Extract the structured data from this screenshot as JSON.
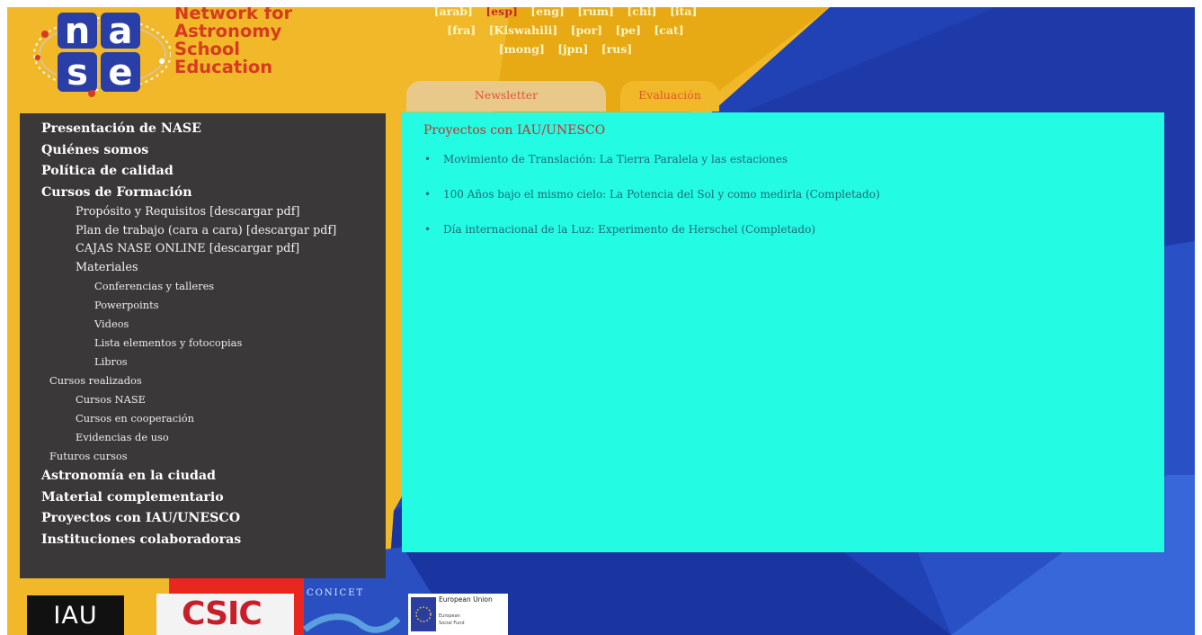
{
  "brand": {
    "title_lines": [
      "Network for",
      "Astronomy",
      "School",
      "Education"
    ],
    "logo_letters": [
      "n",
      "a",
      "s",
      "e"
    ],
    "colors": {
      "brand_red": "#d63a1f",
      "panel_cyan": "#23fbe3",
      "sidebar_dark": "#3b3839",
      "accent_yellow": "#f1b92a",
      "bg_blue": "#2346b8"
    }
  },
  "languages": {
    "rows": [
      [
        "[arab]",
        "[esp]",
        "[eng]",
        "[rum]",
        "[chi]",
        "[ita]"
      ],
      [
        "[fra]",
        "[Kiswahili]",
        "[por]",
        "[pe]",
        "[cat]"
      ],
      [
        "[mong]",
        "[jpn]",
        "[rus]"
      ]
    ],
    "active": "[esp]"
  },
  "tabs": [
    {
      "label": "Newsletter"
    },
    {
      "label": "Evaluación"
    }
  ],
  "sidebar": {
    "items": [
      {
        "label": "Presentación de NASE",
        "level": 0
      },
      {
        "label": "Quiénes somos",
        "level": 0
      },
      {
        "label": "Política de calidad",
        "level": 0
      },
      {
        "label": "Cursos de Formación",
        "level": 0
      },
      {
        "label": "Propósito y Requisitos [descargar pdf]",
        "level": 1
      },
      {
        "label": "Plan de trabajo (cara a cara) [descargar pdf]",
        "level": 1
      },
      {
        "label": "CAJAS NASE ONLINE [descargar pdf]",
        "level": 1
      },
      {
        "label": "Materiales",
        "level": 1
      },
      {
        "label": "Conferencias y talleres",
        "level": 2
      },
      {
        "label": "Powerpoints",
        "level": 2
      },
      {
        "label": "Videos",
        "level": 2
      },
      {
        "label": "Lista elementos y fotocopias",
        "level": 2
      },
      {
        "label": "Libros",
        "level": 2
      },
      {
        "label": "Cursos realizados",
        "level": 3
      },
      {
        "label": "Cursos NASE",
        "level": 4
      },
      {
        "label": "Cursos en cooperación",
        "level": 4
      },
      {
        "label": "Evidencias de uso",
        "level": 4
      },
      {
        "label": "Futuros cursos",
        "level": 3
      },
      {
        "label": "Astronomía en la ciudad",
        "level": 0
      },
      {
        "label": "Material complementario",
        "level": 0
      },
      {
        "label": "Proyectos con IAU/UNESCO",
        "level": 0
      },
      {
        "label": "Instituciones colaboradoras",
        "level": 0
      }
    ]
  },
  "main": {
    "heading": "Proyectos con IAU/UNESCO",
    "bullet": "•",
    "links": [
      "Movimiento de Translación: La Tierra Paralela y las estaciones",
      "100 Años bajo el mismo cielo: La Potencia del Sol y como medirla (Completado)",
      "Día internacional de la Luz: Experimento de Herschel (Completado)"
    ]
  },
  "partners": {
    "iau": "IAU",
    "csic": "CSIC",
    "conicet": "CONICET",
    "eu_title": "European Union",
    "eu_sub": [
      "European",
      "Social Fund"
    ]
  }
}
